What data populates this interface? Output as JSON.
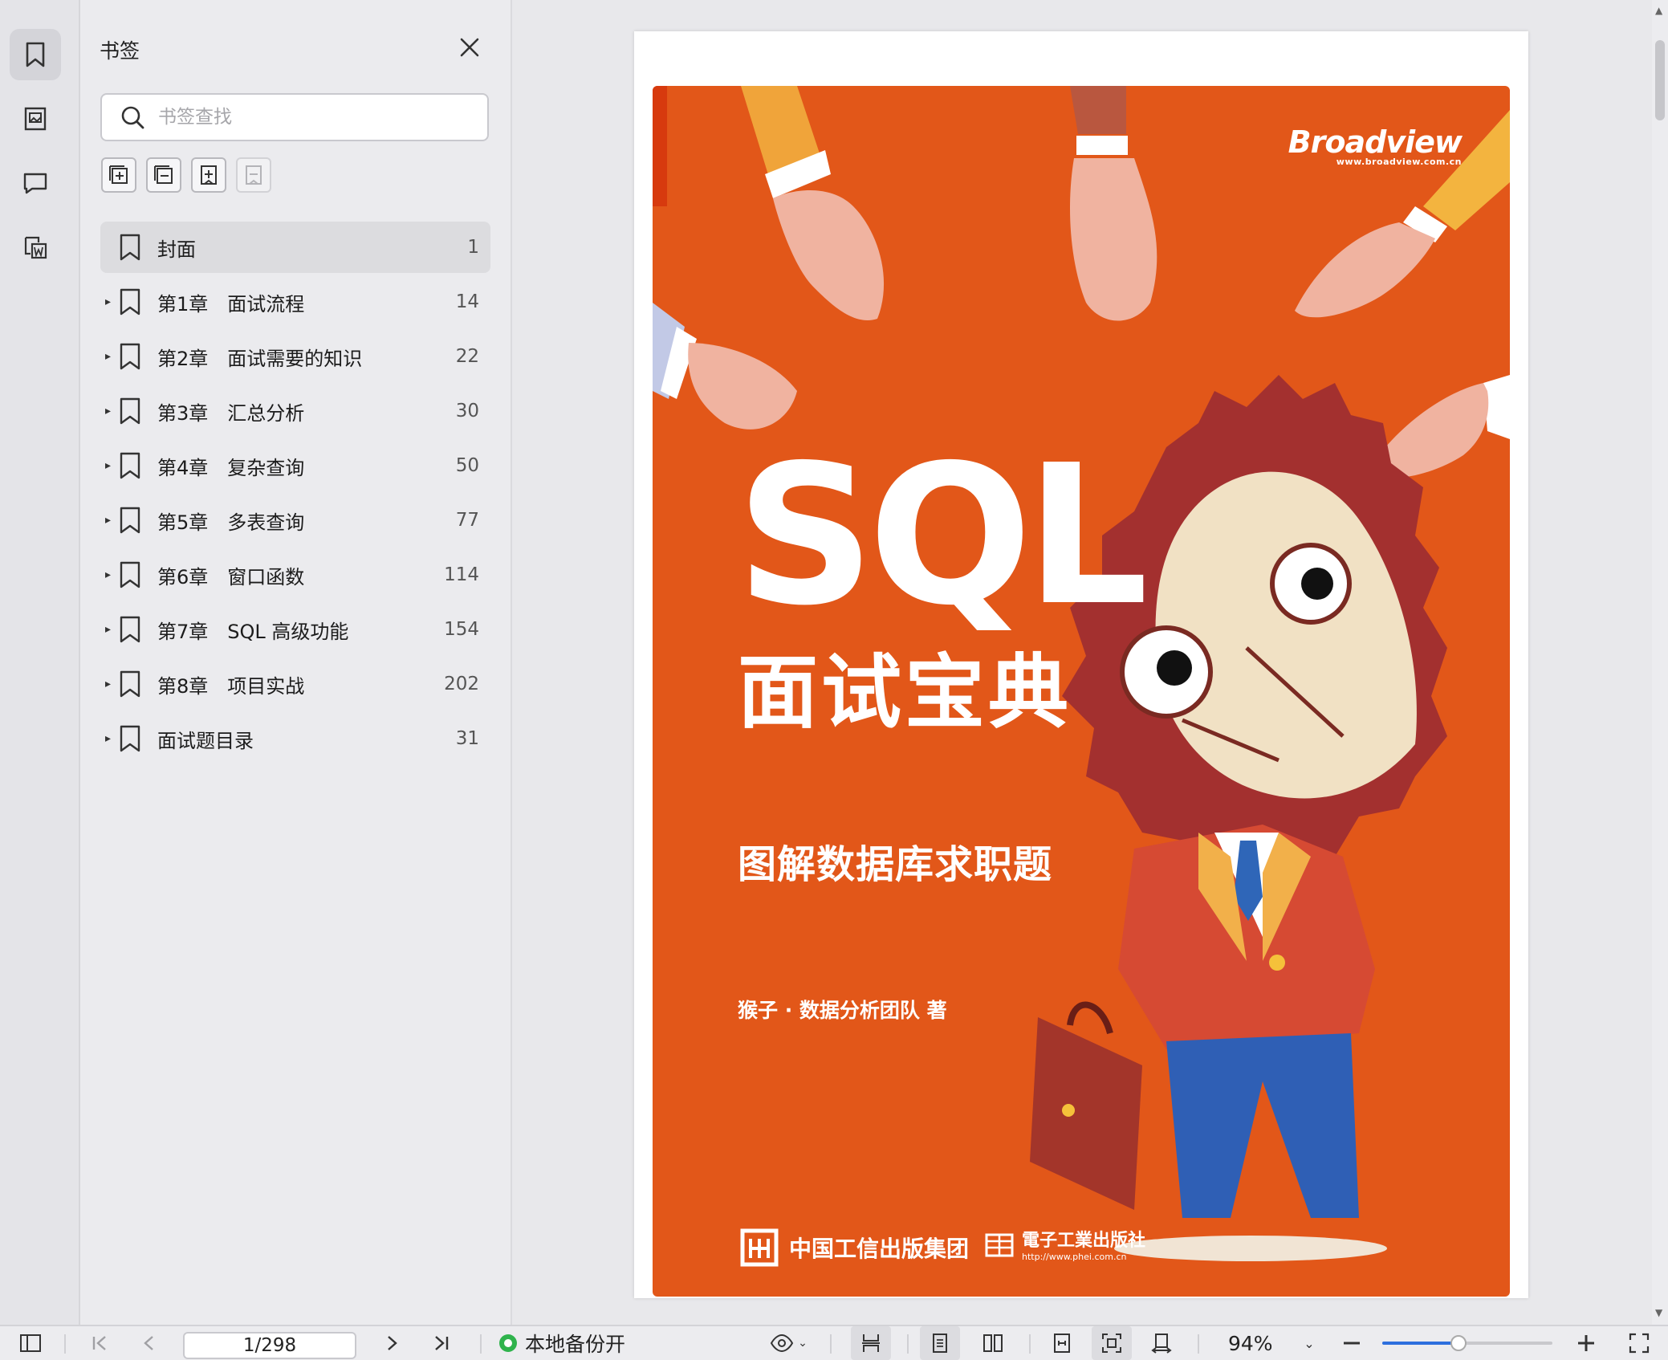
{
  "sidebar_panel": {
    "title": "书签",
    "search_placeholder": "书签查找"
  },
  "bookmarks": [
    {
      "label": "封面",
      "page": "1",
      "expandable": false,
      "selected": true
    },
    {
      "label": "第1章　面试流程",
      "page": "14",
      "expandable": true
    },
    {
      "label": "第2章　面试需要的知识",
      "page": "22",
      "expandable": true
    },
    {
      "label": "第3章　汇总分析",
      "page": "30",
      "expandable": true
    },
    {
      "label": "第4章　复杂查询",
      "page": "50",
      "expandable": true
    },
    {
      "label": "第5章　多表查询",
      "page": "77",
      "expandable": true
    },
    {
      "label": "第6章　窗口函数",
      "page": "114",
      "expandable": true
    },
    {
      "label": "第7章　SQL 高级功能",
      "page": "154",
      "expandable": true
    },
    {
      "label": "第8章　项目实战",
      "page": "202",
      "expandable": true
    },
    {
      "label": "面试题目录",
      "page": "31",
      "expandable": true
    }
  ],
  "cover": {
    "publisher_brand": "Broadview",
    "publisher_url": "www.broadview.com.cn",
    "title_en": "SQL",
    "title_cn": "面试宝典",
    "subtitle": "图解数据库求职题",
    "author": "猴子 · 数据分析团队 著",
    "publisher_group": "中国工信出版集团",
    "publisher_house": "電子工業出版社",
    "publisher_house_url": "http://www.phei.com.cn",
    "background_color": "#e25719"
  },
  "statusbar": {
    "page_indicator": "1/298",
    "backup_label": "本地备份开",
    "zoom_label": "94%",
    "zoom_fraction": 0.45
  },
  "icons": {
    "rail": [
      "bookmark-icon",
      "thumbnail-icon",
      "comment-icon",
      "convert-word-icon"
    ],
    "tools": [
      "expand-all-icon",
      "collapse-all-icon",
      "add-bookmark-icon",
      "delete-bookmark-icon"
    ]
  }
}
